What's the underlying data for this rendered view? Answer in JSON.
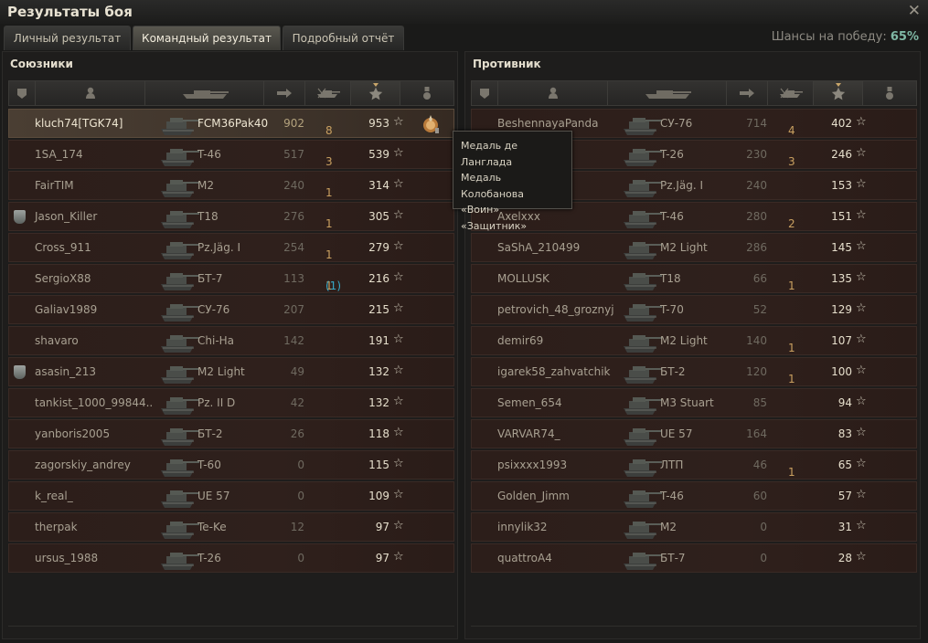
{
  "window": {
    "title": "Результаты боя"
  },
  "tabs": [
    {
      "label": "Личный результат"
    },
    {
      "label": "Командный результат"
    },
    {
      "label": "Подробный отчёт"
    }
  ],
  "win_chance": {
    "label": "Шансы на победу:",
    "value": "65%"
  },
  "allies": {
    "title": "Союзники",
    "rows": [
      {
        "name": "kluch74[TGK74]",
        "vehicle": "FCM36Pak40",
        "damage": "902",
        "kills": "8",
        "xp": "953"
      },
      {
        "name": "1SA_174",
        "vehicle": "T-46",
        "damage": "517",
        "kills": "3",
        "xp": "539"
      },
      {
        "name": "FairTIM",
        "vehicle": "M2",
        "damage": "240",
        "kills": "1",
        "xp": "314"
      },
      {
        "name": "Jason_Killer",
        "vehicle": "T18",
        "damage": "276",
        "kills": "1",
        "xp": "305"
      },
      {
        "name": "Cross_911",
        "vehicle": "Pz.Jäg. I",
        "damage": "254",
        "kills": "1",
        "xp": "279"
      },
      {
        "name": "SergioX88",
        "vehicle": "БТ-7",
        "damage": "113",
        "kills": "1",
        "kills_extra": "(1)",
        "xp": "216"
      },
      {
        "name": "Galiav1989",
        "vehicle": "СУ-76",
        "damage": "207",
        "kills": "",
        "xp": "215"
      },
      {
        "name": "shavaro",
        "vehicle": "Chi-Ha",
        "damage": "142",
        "kills": "",
        "xp": "191"
      },
      {
        "name": "asasin_213",
        "vehicle": "M2 Light",
        "damage": "49",
        "kills": "",
        "xp": "132"
      },
      {
        "name": "tankist_1000_99844..",
        "vehicle": "Pz. II D",
        "damage": "42",
        "kills": "",
        "xp": "132"
      },
      {
        "name": "yanboris2005",
        "vehicle": "БТ-2",
        "damage": "26",
        "kills": "",
        "xp": "118"
      },
      {
        "name": "zagorskiy_andrey",
        "vehicle": "T-60",
        "damage": "0",
        "kills": "",
        "xp": "115"
      },
      {
        "name": "k_real_",
        "vehicle": "UE 57",
        "damage": "0",
        "kills": "",
        "xp": "109"
      },
      {
        "name": "therpak",
        "vehicle": "Te-Ke",
        "damage": "12",
        "kills": "",
        "xp": "97"
      },
      {
        "name": "ursus_1988",
        "vehicle": "T-26",
        "damage": "0",
        "kills": "",
        "xp": "97"
      }
    ]
  },
  "enemies": {
    "title": "Противник",
    "rows": [
      {
        "name": "BeshennayaPanda",
        "vehicle": "СУ-76",
        "damage": "714",
        "kills": "4",
        "xp": "402"
      },
      {
        "name": "",
        "vehicle": "T-26",
        "damage": "230",
        "kills": "3",
        "xp": "246"
      },
      {
        "name": "",
        "vehicle": "Pz.Jäg. I",
        "damage": "240",
        "kills": "",
        "xp": "153"
      },
      {
        "name": "Axelxxx",
        "vehicle": "T-46",
        "damage": "280",
        "kills": "2",
        "xp": "151"
      },
      {
        "name": "SaShA_210499",
        "vehicle": "M2 Light",
        "damage": "286",
        "kills": "",
        "xp": "145"
      },
      {
        "name": "MOLLUSK",
        "vehicle": "T18",
        "damage": "66",
        "kills": "1",
        "xp": "135"
      },
      {
        "name": "petrovich_48_groznyj",
        "vehicle": "T-70",
        "damage": "52",
        "kills": "",
        "xp": "129"
      },
      {
        "name": "demir69",
        "vehicle": "M2 Light",
        "damage": "140",
        "kills": "1",
        "xp": "107"
      },
      {
        "name": "igarek58_zahvatchik",
        "vehicle": "БТ-2",
        "damage": "120",
        "kills": "1",
        "xp": "100"
      },
      {
        "name": "Semen_654",
        "vehicle": "M3 Stuart",
        "damage": "85",
        "kills": "",
        "xp": "94"
      },
      {
        "name": "VARVAR74_",
        "vehicle": "UE 57",
        "damage": "164",
        "kills": "",
        "xp": "83"
      },
      {
        "name": "psixxxx1993",
        "vehicle": "ЛТП",
        "damage": "46",
        "kills": "1",
        "xp": "65"
      },
      {
        "name": "Golden_Jimm",
        "vehicle": "T-46",
        "damage": "60",
        "kills": "",
        "xp": "57"
      },
      {
        "name": "innylik32",
        "vehicle": "M2",
        "damage": "0",
        "kills": "",
        "xp": "31"
      },
      {
        "name": "quattroA4",
        "vehicle": "БТ-7",
        "damage": "0",
        "kills": "",
        "xp": "28"
      }
    ]
  },
  "tooltip": {
    "lines": [
      "Медаль де Ланглада",
      "Медаль Колобанова",
      "«Воин»",
      "«Защитник»"
    ]
  },
  "colors": {
    "accent_gold": "#c9a060",
    "chance_green": "#7fb8a5",
    "highlight_blue": "#37a8c7"
  }
}
